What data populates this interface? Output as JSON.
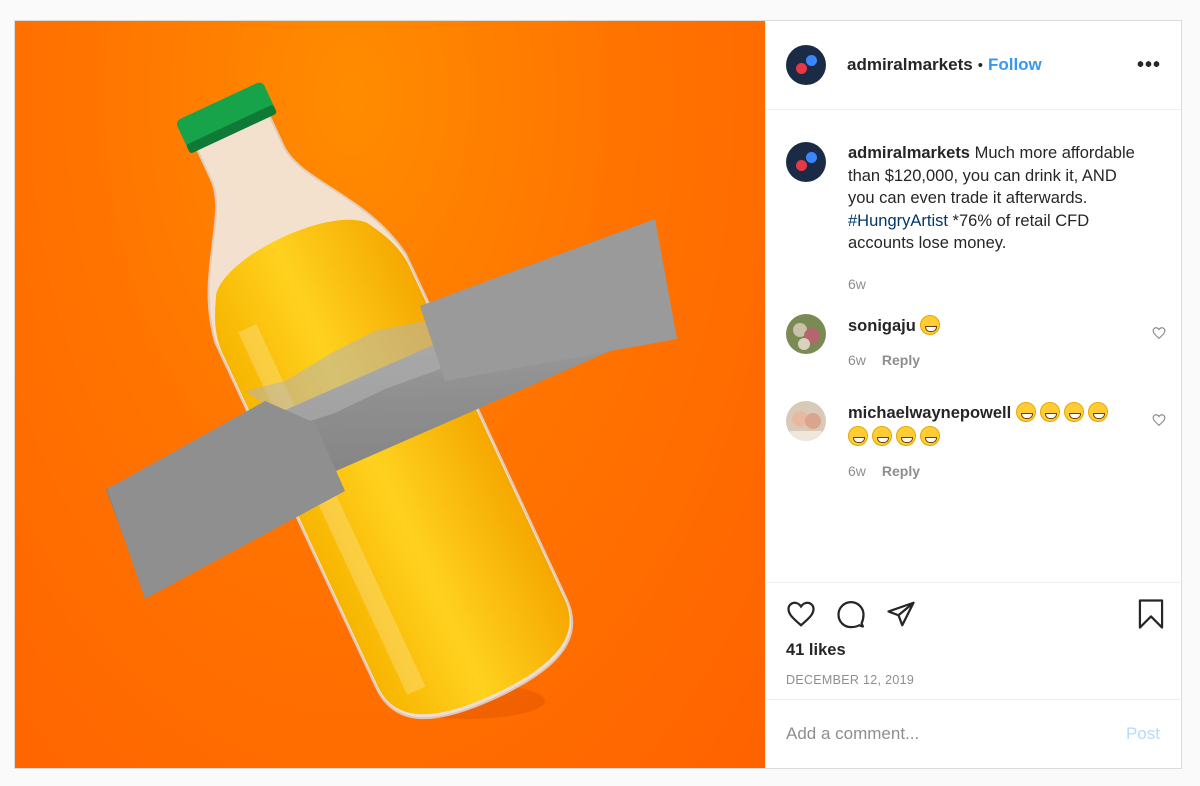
{
  "header": {
    "username": "admiralmarkets",
    "separator": "•",
    "follow_label": "Follow",
    "more_label": "•••"
  },
  "caption": {
    "username": "admiralmarkets",
    "text_before": "Much more affordable than $120,000, you can drink it, AND you can even trade it afterwards.",
    "hashtag": "#HungryArtist",
    "text_after": "*76% of retail CFD accounts lose money.",
    "time": "6w"
  },
  "comments": [
    {
      "username": "sonigaju",
      "time": "6w",
      "reply_label": "Reply"
    },
    {
      "username": "michaelwaynepowell",
      "time": "6w",
      "reply_label": "Reply"
    }
  ],
  "actions": {
    "likes": "41 likes",
    "date": "DECEMBER 12, 2019"
  },
  "comment_box": {
    "placeholder": "Add a comment...",
    "post_label": "Post"
  },
  "colors": {
    "accent": "#3897f0",
    "background_orange": "#ff7400",
    "logo_navy": "#1b2a45"
  },
  "icons": [
    "heart-icon",
    "comment-icon",
    "share-icon",
    "bookmark-icon",
    "more-options-icon",
    "grinning-emoji",
    "laughing-emoji"
  ]
}
